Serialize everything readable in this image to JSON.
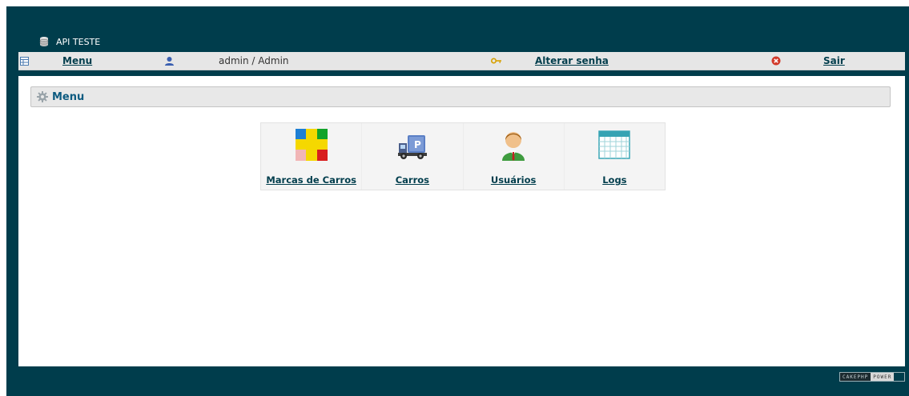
{
  "app": {
    "title": "API TESTE"
  },
  "navbar": {
    "menu_label": "Menu",
    "user_label": "admin / Admin",
    "change_password_label": "Alterar senha",
    "logout_label": "Sair"
  },
  "main": {
    "section_title": "Menu",
    "tiles": [
      {
        "label": "Marcas de Carros",
        "icon": "brands-grid-icon"
      },
      {
        "label": "Carros",
        "icon": "truck-icon"
      },
      {
        "label": "Usuários",
        "icon": "user-icon"
      },
      {
        "label": "Logs",
        "icon": "calendar-icon"
      }
    ]
  },
  "footer": {
    "badge_left": "CAKEPHP",
    "badge_right": "POWER"
  },
  "colors": {
    "frame": "#003d4c",
    "navbar": "#e6e6e6",
    "link": "#003d4c",
    "section_title": "#0d5b80"
  }
}
